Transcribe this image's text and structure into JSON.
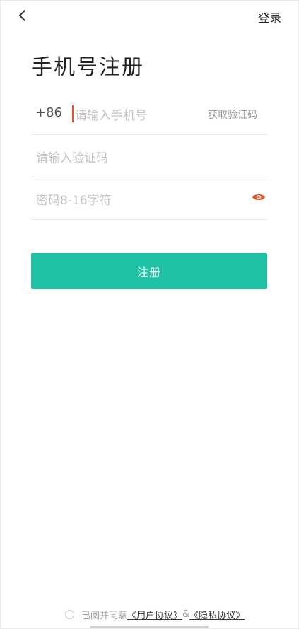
{
  "header": {
    "back_icon": "chevron-left-icon",
    "login_label": "登录"
  },
  "title": "手机号注册",
  "phone_field": {
    "country_code": "+86",
    "placeholder": "请输入手机号",
    "get_code_label": "获取验证码"
  },
  "code_field": {
    "placeholder": "请输入验证码"
  },
  "password_field": {
    "placeholder": "密码8-16字符",
    "toggle_icon": "eye-icon"
  },
  "register_button": {
    "label": "注册"
  },
  "agreement": {
    "prefix": "已阅并同意",
    "user_agreement": "《用户协议》",
    "separator": "&",
    "privacy_policy": "《隐私协议》"
  },
  "colors": {
    "primary": "#1fc1a4",
    "accent": "#e4542c"
  }
}
